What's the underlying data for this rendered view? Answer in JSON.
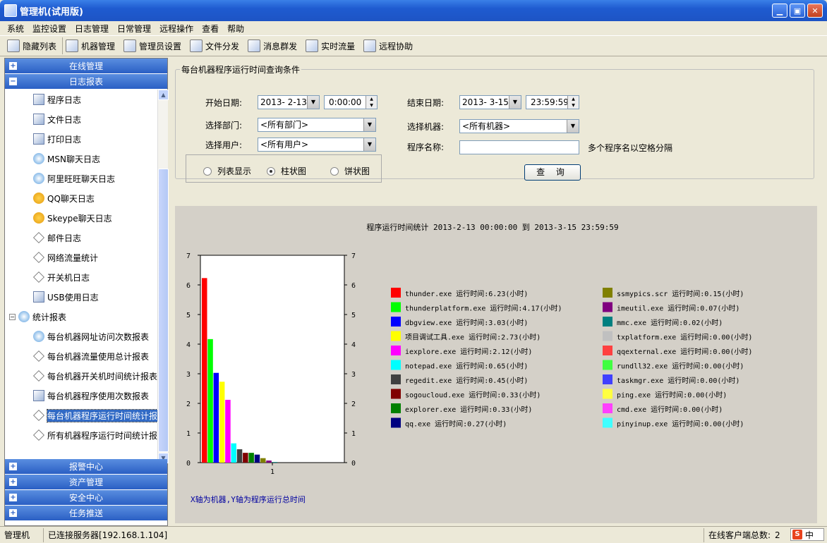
{
  "window": {
    "title": "管理机(试用版)"
  },
  "menu": [
    "系统",
    "监控设置",
    "日志管理",
    "日常管理",
    "远程操作",
    "查看",
    "帮助"
  ],
  "toolbar": [
    "隐藏列表",
    "机器管理",
    "管理员设置",
    "文件分发",
    "消息群发",
    "实时流量",
    "远程协助"
  ],
  "sidebar": {
    "groups_top": [
      {
        "label": "在线管理",
        "expander": "+"
      },
      {
        "label": "日志报表",
        "expander": "−"
      }
    ],
    "items": [
      {
        "label": "程序日志",
        "icon": "report-icon"
      },
      {
        "label": "文件日志",
        "icon": "file-log-icon"
      },
      {
        "label": "打印日志",
        "icon": "print-icon"
      },
      {
        "label": "MSN聊天日志",
        "icon": "msn-icon"
      },
      {
        "label": "阿里旺旺聊天日志",
        "icon": "wangwang-icon"
      },
      {
        "label": "QQ聊天日志",
        "icon": "qq-icon"
      },
      {
        "label": "Skeype聊天日志",
        "icon": "skype-icon"
      },
      {
        "label": "邮件日志",
        "icon": "mail-icon"
      },
      {
        "label": "网络流量统计",
        "icon": "network-icon"
      },
      {
        "label": "开关机日志",
        "icon": "power-icon"
      },
      {
        "label": "USB使用日志",
        "icon": "usb-icon"
      }
    ],
    "stats_node": {
      "label": "统计报表",
      "expander": "−"
    },
    "stats_items": [
      {
        "label": "每台机器网址访问次数报表"
      },
      {
        "label": "每台机器流量使用总计报表"
      },
      {
        "label": "每台机器开关机时间统计报表"
      },
      {
        "label": "每台机器程序使用次数报表"
      },
      {
        "label": "每台机器程序运行时间统计报",
        "selected": true
      },
      {
        "label": "所有机器程序运行时间统计报"
      }
    ],
    "groups_bottom": [
      {
        "label": "报警中心",
        "expander": "+"
      },
      {
        "label": "资产管理",
        "expander": "+"
      },
      {
        "label": "安全中心",
        "expander": "+"
      },
      {
        "label": "任务推送",
        "expander": "+"
      }
    ]
  },
  "query": {
    "legend": "每台机器程序运行时间查询条件",
    "start_date_label": "开始日期:",
    "start_date": "2013- 2-13",
    "start_time": "0:00:00",
    "end_date_label": "结束日期:",
    "end_date": "2013- 3-15",
    "end_time": "23:59:59",
    "dept_label": "选择部门:",
    "dept_value": "<所有部门>",
    "machine_label": "选择机器:",
    "machine_value": "<所有机器>",
    "user_label": "选择用户:",
    "user_value": "<所有用户>",
    "program_label": "程序名称:",
    "program_value": "",
    "program_hint": "多个程序名以空格分隔",
    "view_options": [
      "列表显示",
      "柱状图",
      "饼状图"
    ],
    "view_selected": 1,
    "query_button": "查 询"
  },
  "chart_data": {
    "type": "bar",
    "title": "程序运行时间统计 2013-2-13 00:00:00 到 2013-3-15 23:59:59",
    "categories": [
      "1"
    ],
    "ylim": [
      0,
      7
    ],
    "yticks": [
      "0",
      "1",
      "2",
      "3",
      "4",
      "5",
      "6",
      "7"
    ],
    "footnote": "X轴为机器,Y轴为程序运行总时间",
    "value_prefix": "运行时间:",
    "value_suffix": "(小时)",
    "series": [
      {
        "name": "thunder.exe",
        "value": 6.23,
        "value_text": "6.23",
        "color": "#ff0000"
      },
      {
        "name": "thunderplatform.exe",
        "value": 4.17,
        "value_text": "4.17",
        "color": "#00ff00"
      },
      {
        "name": "dbgview.exe",
        "value": 3.03,
        "value_text": "3.03",
        "color": "#0000ff"
      },
      {
        "name": "项目调试工具.exe",
        "value": 2.73,
        "value_text": "2.73",
        "color": "#ffff00"
      },
      {
        "name": "iexplore.exe",
        "value": 2.12,
        "value_text": "2.12",
        "color": "#ff00ff"
      },
      {
        "name": "notepad.exe",
        "value": 0.65,
        "value_text": "0.65",
        "color": "#00ffff"
      },
      {
        "name": "regedit.exe",
        "value": 0.45,
        "value_text": "0.45",
        "color": "#404040"
      },
      {
        "name": "sogoucloud.exe",
        "value": 0.33,
        "value_text": "0.33",
        "color": "#800000"
      },
      {
        "name": "explorer.exe",
        "value": 0.33,
        "value_text": "0.33",
        "color": "#008000"
      },
      {
        "name": "qq.exe",
        "value": 0.27,
        "value_text": "0.27",
        "color": "#000080"
      },
      {
        "name": "ssmypics.scr",
        "value": 0.15,
        "value_text": "0.15",
        "color": "#808000"
      },
      {
        "name": "imeutil.exe",
        "value": 0.07,
        "value_text": "0.07",
        "color": "#800080"
      },
      {
        "name": "mmc.exe",
        "value": 0.02,
        "value_text": "0.02",
        "color": "#008080"
      },
      {
        "name": "txplatform.exe",
        "value": 0.0,
        "value_text": "0.00",
        "color": "#c0c0c0"
      },
      {
        "name": "qqexternal.exe",
        "value": 0.0,
        "value_text": "0.00",
        "color": "#ff4040"
      },
      {
        "name": "rundll32.exe",
        "value": 0.0,
        "value_text": "0.00",
        "color": "#40ff40"
      },
      {
        "name": "taskmgr.exe",
        "value": 0.0,
        "value_text": "0.00",
        "color": "#4040ff"
      },
      {
        "name": "ping.exe",
        "value": 0.0,
        "value_text": "0.00",
        "color": "#ffff40"
      },
      {
        "name": "cmd.exe",
        "value": 0.0,
        "value_text": "0.00",
        "color": "#ff40ff"
      },
      {
        "name": "pinyinup.exe",
        "value": 0.0,
        "value_text": "0.00",
        "color": "#40ffff"
      }
    ]
  },
  "status": {
    "app": "管理机",
    "connection": "已连接服务器[192.168.1.104]",
    "online_label": "在线客户端总数:",
    "online_count": "2"
  },
  "ime": {
    "label": "中"
  }
}
